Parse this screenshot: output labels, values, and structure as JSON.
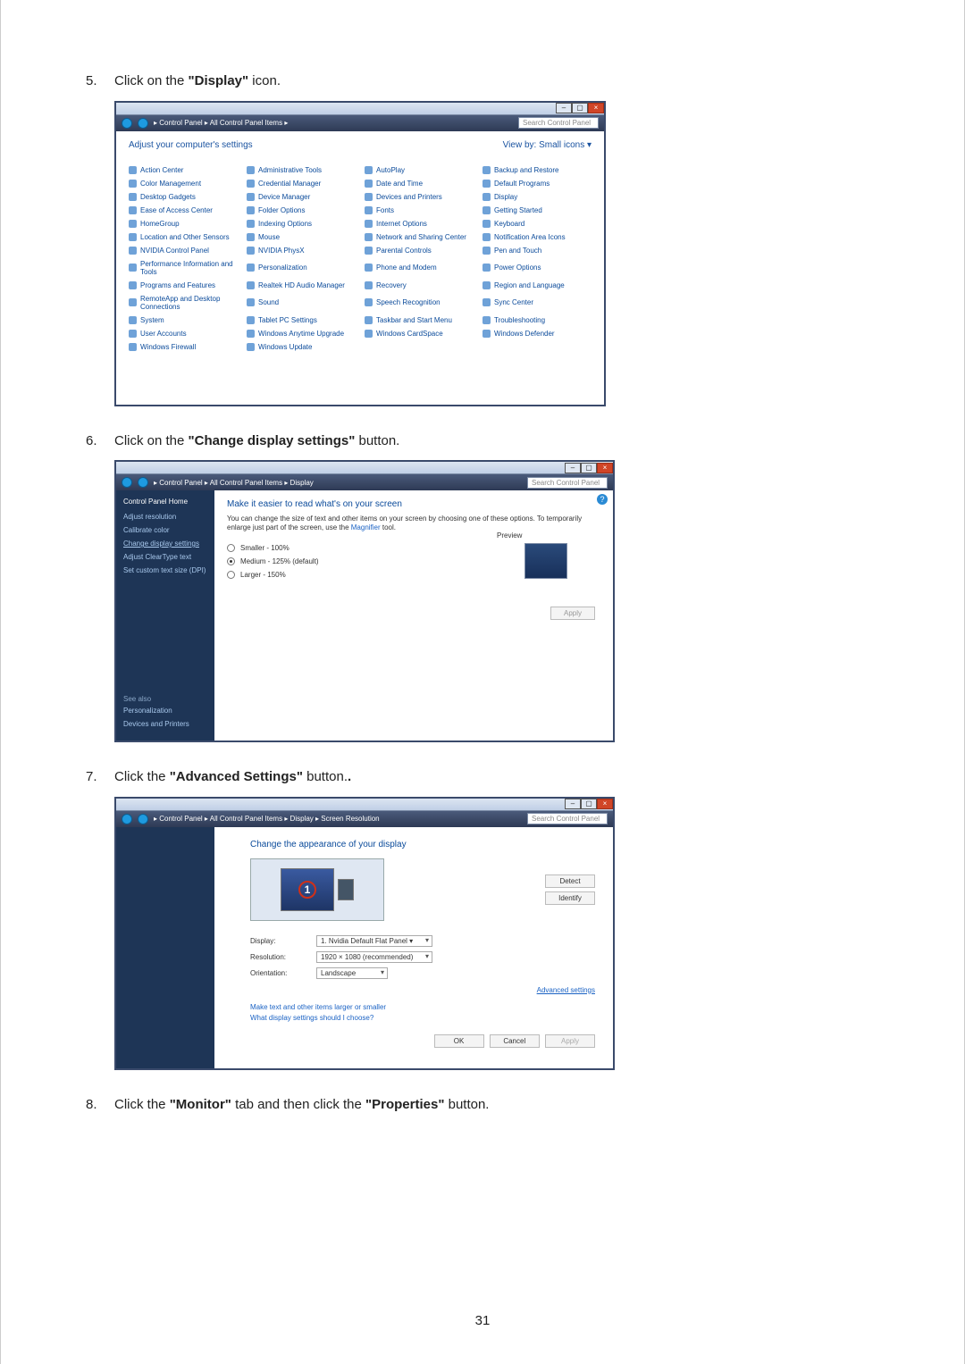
{
  "page_number": "31",
  "steps": [
    {
      "num": "5.",
      "pre": "Click on the ",
      "bold": "\"Display\"",
      "post": " icon."
    },
    {
      "num": "6.",
      "pre": "Click on the ",
      "bold": "\"Change display settings\"",
      "post": " button."
    },
    {
      "num": "7.",
      "pre": "Click the ",
      "bold": "\"Advanced Settings\"",
      "post": " button."
    },
    {
      "num": "8.",
      "pre": "Click the ",
      "bold": "\"Monitor\"",
      "post_mid": " tab and then click the ",
      "bold2": "\"Properties\"",
      "post": " button."
    }
  ],
  "searchbox_ph": "Search Control Panel",
  "cp": {
    "breadcrumb": "▸ Control Panel ▸ All Control Panel Items ▸",
    "heading": "Adjust your computer's settings",
    "view_by": "View by:   Small icons ▾",
    "items": [
      "Action Center",
      "Administrative Tools",
      "AutoPlay",
      "Backup and Restore",
      "Color Management",
      "Credential Manager",
      "Date and Time",
      "Default Programs",
      "Desktop Gadgets",
      "Device Manager",
      "Devices and Printers",
      "Display",
      "Ease of Access Center",
      "Folder Options",
      "Fonts",
      "Getting Started",
      "HomeGroup",
      "Indexing Options",
      "Internet Options",
      "Keyboard",
      "Location and Other Sensors",
      "Mouse",
      "Network and Sharing Center",
      "Notification Area Icons",
      "NVIDIA Control Panel",
      "NVIDIA PhysX",
      "Parental Controls",
      "Pen and Touch",
      "Performance Information and Tools",
      "Personalization",
      "Phone and Modem",
      "Power Options",
      "Programs and Features",
      "Realtek HD Audio Manager",
      "Recovery",
      "Region and Language",
      "RemoteApp and Desktop Connections",
      "Sound",
      "Speech Recognition",
      "Sync Center",
      "System",
      "Tablet PC Settings",
      "Taskbar and Start Menu",
      "Troubleshooting",
      "User Accounts",
      "Windows Anytime Upgrade",
      "Windows CardSpace",
      "Windows Defender",
      "Windows Firewall",
      "Windows Update"
    ]
  },
  "ds": {
    "breadcrumb": "▸ Control Panel ▸ All Control Panel Items ▸ Display",
    "side_home": "Control Panel Home",
    "side_links": [
      "Adjust resolution",
      "Calibrate color",
      "Change display settings",
      "Adjust ClearType text",
      "Set custom text size (DPI)"
    ],
    "see_also": "See also",
    "see_also_items": [
      "Personalization",
      "Devices and Printers"
    ],
    "title": "Make it easier to read what's on your screen",
    "desc_pre": "You can change the size of text and other items on your screen by choosing one of these options. To temporarily enlarge just part of the screen, use the ",
    "desc_link": "Magnifier",
    "desc_post": " tool.",
    "opt1": "Smaller - 100%",
    "opt2": "Medium - 125% (default)",
    "opt3": "Larger - 150%",
    "preview": "Preview",
    "apply": "Apply"
  },
  "sr": {
    "breadcrumb": "▸ Control Panel ▸ All Control Panel Items ▸ Display ▸ Screen Resolution",
    "title": "Change the appearance of your display",
    "detect": "Detect",
    "identify": "Identify",
    "monitor_number": "1",
    "display_lbl": "Display:",
    "display_val": "1. Nvidia Default Flat Panel ▾",
    "res_lbl": "Resolution:",
    "res_val": "1920 × 1080 (recommended)",
    "orient_lbl": "Orientation:",
    "orient_val": "Landscape",
    "adv": "Advanced settings",
    "help1": "Make text and other items larger or smaller",
    "help2": "What display settings should I choose?",
    "ok": "OK",
    "cancel": "Cancel",
    "apply": "Apply"
  }
}
